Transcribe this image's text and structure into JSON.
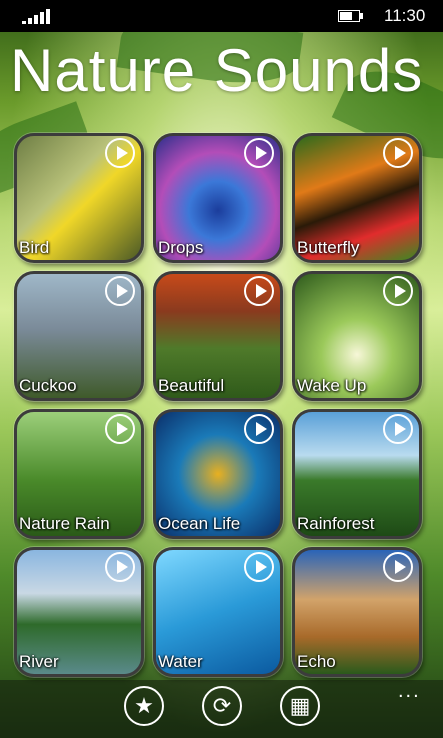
{
  "status_bar": {
    "time": "11:30"
  },
  "app": {
    "title": "Nature Sounds"
  },
  "tiles": [
    {
      "label": "Bird"
    },
    {
      "label": "Drops"
    },
    {
      "label": "Butterfly"
    },
    {
      "label": "Cuckoo"
    },
    {
      "label": "Beautiful"
    },
    {
      "label": "Wake Up"
    },
    {
      "label": "Nature Rain"
    },
    {
      "label": "Ocean Life"
    },
    {
      "label": "Rainforest"
    },
    {
      "label": "River"
    },
    {
      "label": "Water"
    },
    {
      "label": "Echo"
    }
  ],
  "app_bar": {
    "buttons": [
      {
        "icon": "star-icon",
        "glyph": "★"
      },
      {
        "icon": "refresh-icon",
        "glyph": "⟳"
      },
      {
        "icon": "windows-store-icon",
        "glyph": "▦"
      }
    ],
    "more": "..."
  },
  "colors": {
    "tile_border": "#3c3c3c",
    "accent_leaf_green": "#6b9b2b"
  }
}
